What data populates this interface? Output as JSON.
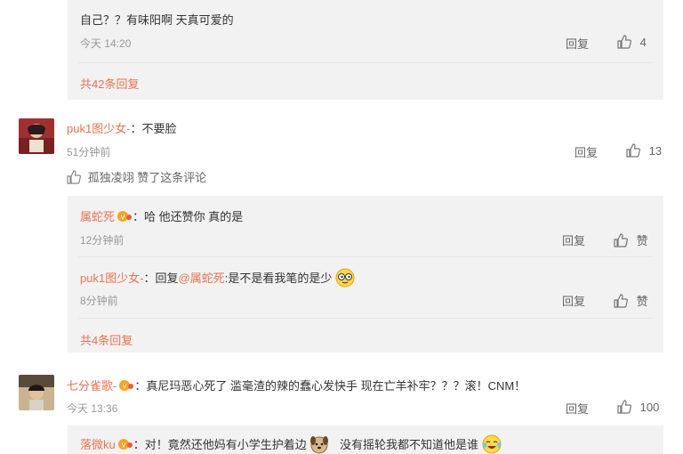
{
  "comments": [
    {
      "replies": [
        {
          "text": "自己？？有味阳啊 天真可爱的",
          "time": "今天 14:20",
          "reply_label": "回复",
          "likes": "4"
        }
      ],
      "more_replies": "共42条回复"
    },
    {
      "author": "puk1图少女-",
      "text": "：不要脸",
      "time": "51分钟前",
      "reply_label": "回复",
      "likes": "13",
      "liked_by": "孤独凌翊 赞了这条评论",
      "replies": [
        {
          "author": "属蛇死",
          "text": "：哈  他还赞你  真的是",
          "time": "12分钟前",
          "reply_label": "回复",
          "likes": "赞"
        },
        {
          "author": "puk1图少女-",
          "reply_prefix": "：回复",
          "mention": "@属蛇死",
          "text": ":是不是看我笔的是少",
          "time": "8分钟前",
          "reply_label": "回复",
          "likes": "赞"
        }
      ],
      "more_replies": "共4条回复"
    },
    {
      "author": "七分雀歌-",
      "text": "：真尼玛恶心死了 滥毫渣的辣的蠢心发快手 现在亡羊补牢？？？滚！CNM！",
      "time": "今天 13:36",
      "reply_label": "回复",
      "likes": "100",
      "replies": [
        {
          "author": "落微ku",
          "text": "：对！竟然还他妈有小学生护着边",
          "text2": "没有摇轮我都不知道他是谁"
        }
      ]
    }
  ],
  "colors": {
    "name": "#eb7350",
    "panel": "#f2f2f2",
    "meta": "#999999"
  }
}
